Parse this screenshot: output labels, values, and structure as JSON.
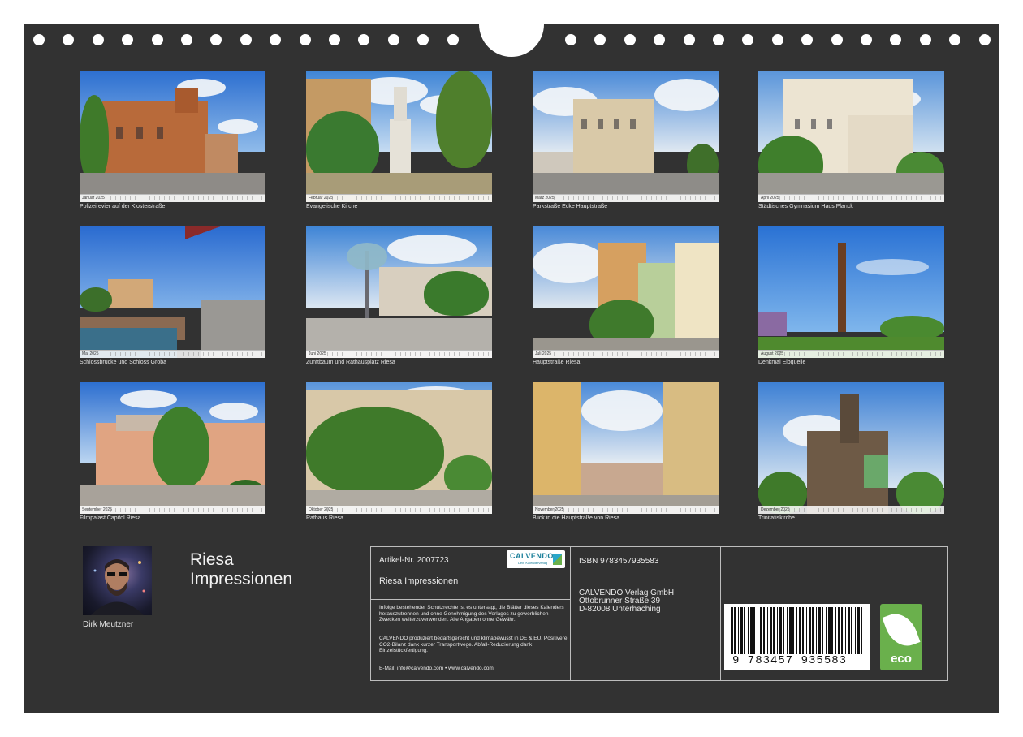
{
  "months": [
    {
      "month": "Januar 2025",
      "caption": "Polizeirevier auf der Klosterstraße"
    },
    {
      "month": "Februar 2025",
      "caption": "Evangelische Kirche"
    },
    {
      "month": "März 2025",
      "caption": "Parkstraße Ecke Hauptstraße"
    },
    {
      "month": "April 2025",
      "caption": "Städtisches Gymnasium Haus Planck"
    },
    {
      "month": "Mai 2025",
      "caption": "Schlossbrücke und Schloss Gröba"
    },
    {
      "month": "Juni 2025",
      "caption": "Zunftbaum und Rathausplatz Riesa"
    },
    {
      "month": "Juli 2025",
      "caption": "Hauptstraße Riesa"
    },
    {
      "month": "August 2025",
      "caption": "Denkmal Elbquelle"
    },
    {
      "month": "September 2025",
      "caption": "Filmpalast Capitol Riesa"
    },
    {
      "month": "Oktober 2025",
      "caption": "Rathaus Riesa"
    },
    {
      "month": "November 2025",
      "caption": "Blick in die Hauptstraße von Riesa"
    },
    {
      "month": "Dezember 2025",
      "caption": "Trinitatiskirche"
    }
  ],
  "author": {
    "name": "Dirk Meutzner"
  },
  "title": {
    "line1": "Riesa",
    "line2": "Impressionen"
  },
  "info": {
    "article": "Artikel-Nr. 2007723",
    "short_title": "Riesa Impressionen",
    "logo_text": "CALVENDO",
    "logo_sub": "Dein Kalenderverlag",
    "legal1": "Infolge bestehender Schutzrechte ist es untersagt, die Blätter dieses Kalenders herauszutrennen und ohne Genehmigung des Verlages zu gewerblichen Zwecken weiterzuverwenden. Alle Angaben ohne Gewähr.",
    "legal2": "CALVENDO produziert bedarfsgerecht und klimabewusst in DE & EU. Positivere CO2-Bilanz dank kurzer Transportwege. Abfall-Reduzierung dank Einzelstückfertigung.",
    "email": "E-Mail: info@calvendo.com • www.calvendo.com",
    "isbn": "ISBN 9783457935583",
    "publisher1": "CALVENDO Verlag GmbH",
    "publisher2": "Ottobrunner Straße 39",
    "publisher3": "D-82008 Unterhaching",
    "barcode_digits": "9 783457 935583",
    "eco_label": "eco"
  },
  "colors": {
    "background": "#323232",
    "text": "#e6e6e6",
    "eco_green": "#6ab04c",
    "calvendo_blue": "#1b7f9a"
  }
}
